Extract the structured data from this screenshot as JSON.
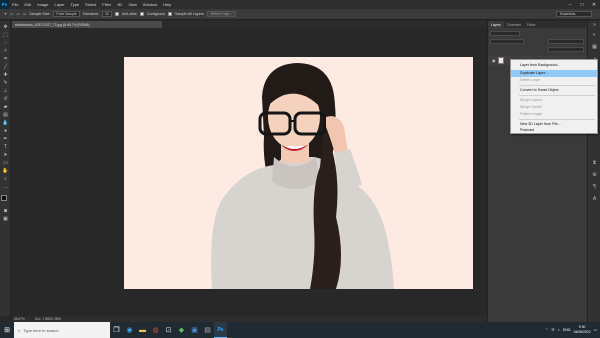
{
  "menubar": {
    "logo": "Ps",
    "items": [
      "File",
      "Edit",
      "Image",
      "Layer",
      "Type",
      "Select",
      "Filter",
      "3D",
      "View",
      "Window",
      "Help"
    ],
    "controls": [
      "–",
      "□",
      "✕"
    ]
  },
  "options": {
    "sample_size_label": "Sample Size:",
    "sample_size_value": "Point Sample",
    "tolerance_label": "Tolerance:",
    "tolerance_value": "32",
    "anti_alias": "Anti-alias",
    "contiguous": "Contiguous",
    "sample_all_layers": "Sample All Layers",
    "refine_edge": "Refine Edge...",
    "workspace": "Essentials"
  },
  "document": {
    "tab_title": "shutterstock_425174317_72.jpg @ 66.7% (RGB/8)",
    "zoom": "66.67%",
    "doc_info": "Doc: 1.98M/1.98M"
  },
  "panel": {
    "tabs": [
      "Layers",
      "Channels",
      "Paths"
    ],
    "active_tab": "Layers"
  },
  "context_menu": {
    "items": [
      {
        "label": "Layer from Background...",
        "disabled": false,
        "highlighted": false
      },
      {
        "label": "Duplicate Layer...",
        "disabled": false,
        "highlighted": true
      },
      {
        "label": "Delete Layer",
        "disabled": true,
        "highlighted": false
      },
      {
        "label": "Convert to Smart Object",
        "disabled": false,
        "highlighted": false
      },
      {
        "label": "Merge Layers",
        "disabled": true,
        "highlighted": false
      },
      {
        "label": "Merge Visible",
        "disabled": true,
        "highlighted": false
      },
      {
        "label": "Flatten Image",
        "disabled": true,
        "highlighted": false
      },
      {
        "label": "New 3D Layer from File...",
        "disabled": false,
        "highlighted": false
      },
      {
        "label": "Postcard",
        "disabled": false,
        "highlighted": false
      }
    ]
  },
  "taskbar": {
    "search_placeholder": "Type here to search",
    "tray_lang": "ENG",
    "time": "9:30",
    "date": "04/06/2022"
  },
  "colors": {
    "canvas_bg": "#fdeae3",
    "highlight": "#91c9f7",
    "ps_blue": "#31a8ff"
  }
}
